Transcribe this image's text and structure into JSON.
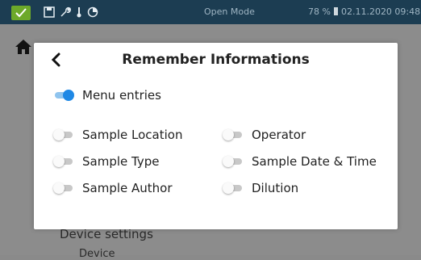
{
  "status_bar": {
    "mode": "Open Mode",
    "battery": "78 %",
    "datetime": "02.11.2020 09:48"
  },
  "background": {
    "device_settings": "Device settings",
    "row2_partial": "Device"
  },
  "dialog": {
    "title": "Remember Informations",
    "menu_entries": {
      "label": "Menu entries",
      "enabled": true
    },
    "options_left": [
      {
        "label": "Sample Location",
        "enabled": false
      },
      {
        "label": "Sample Type",
        "enabled": false
      },
      {
        "label": "Sample Author",
        "enabled": false
      }
    ],
    "options_right": [
      {
        "label": "Operator",
        "enabled": false
      },
      {
        "label": "Sample Date & Time",
        "enabled": false
      },
      {
        "label": "Dilution",
        "enabled": false
      }
    ]
  },
  "colors": {
    "status_bar_bg": "#1c3d52",
    "status_ok": "#6da92a",
    "toggle_on": "#1e88e5"
  }
}
